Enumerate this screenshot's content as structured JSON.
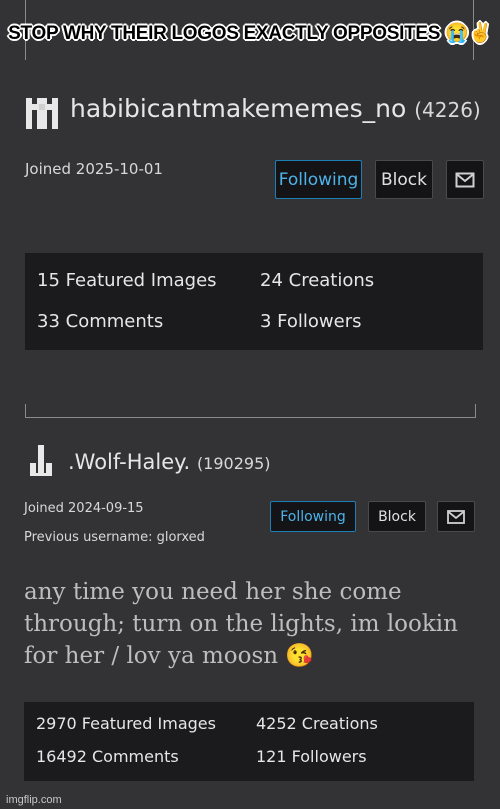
{
  "caption": "STOP WHY THEIR LOGOS EXACTLY OPPOSITES 😭✌️",
  "profile1": {
    "username": "habibicantmakememes_no",
    "score": "(4226)",
    "joined": "Joined 2025-10-01",
    "following_label": "Following",
    "block_label": "Block",
    "message_icon": "envelope-icon",
    "stats": {
      "featured": "15 Featured Images",
      "creations": "24 Creations",
      "comments": "33 Comments",
      "followers": "3 Followers"
    }
  },
  "profile2": {
    "username": ".Wolf-Haley.",
    "score": "(190295)",
    "joined": "Joined 2024-09-15",
    "previous": "Previous username: glorxed",
    "following_label": "Following",
    "block_label": "Block",
    "message_icon": "envelope-icon",
    "bio": "any time you need her she come through; turn on the lights, im lookin for her / lov ya moosn 😘",
    "stats": {
      "featured": "2970 Featured Images",
      "creations": "4252 Creations",
      "comments": "16492 Comments",
      "followers": "121 Followers"
    }
  },
  "watermark": "imgflip.com",
  "colors": {
    "background": "#333335",
    "accent": "#4db3ea",
    "stats_bg": "#1b1b1d"
  }
}
